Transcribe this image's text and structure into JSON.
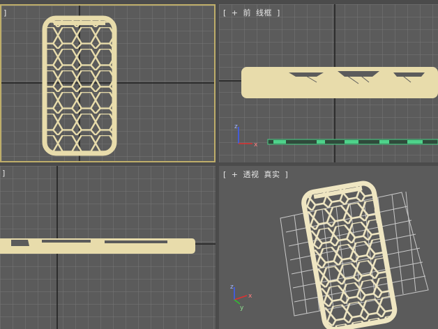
{
  "viewports": {
    "top": {
      "label_bracket": "]"
    },
    "front": {
      "bracket_open": "[",
      "plus": "+",
      "name": "前",
      "shading": "线框",
      "bracket_close": "]"
    },
    "left": {
      "label_bracket": "]"
    },
    "perspective": {
      "bracket_open": "[",
      "plus": "+",
      "name": "透视",
      "shading": "真实",
      "bracket_close": "]"
    }
  },
  "gizmo": {
    "x": "x",
    "y": "y",
    "z": "z"
  },
  "colors": {
    "viewport_bg": "#5b5b5b",
    "grid": "#777777",
    "grid_axis": "#1e1e1e",
    "mesh": "#e8dcab",
    "active_border": "#bfae6a",
    "selection_green": "#4ed28a"
  }
}
